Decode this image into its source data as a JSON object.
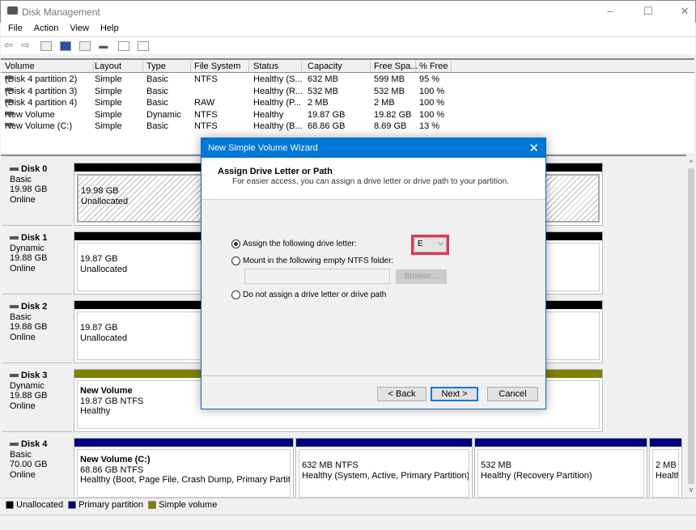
{
  "window": {
    "title": "Disk Management",
    "minimize": "–",
    "maximize": "☐",
    "close": "✕"
  },
  "menu": [
    "File",
    "Action",
    "View",
    "Help"
  ],
  "toolbar": [
    "back-icon",
    "forward-icon",
    "console-tree-icon",
    "help-icon",
    "action-pane-icon",
    "rescan-icon",
    "check-icon",
    "properties-icon"
  ],
  "volume_list": {
    "columns": [
      "Volume",
      "Layout",
      "Type",
      "File System",
      "Status",
      "Capacity",
      "Free Spa...",
      "% Free"
    ],
    "rows": [
      [
        "(Disk 4 partition 2)",
        "Simple",
        "Basic",
        "NTFS",
        "Healthy (S...",
        "632 MB",
        "599 MB",
        "95 %"
      ],
      [
        "(Disk 4 partition 3)",
        "Simple",
        "Basic",
        "",
        "Healthy (R...",
        "532 MB",
        "532 MB",
        "100 %"
      ],
      [
        "(Disk 4 partition 4)",
        "Simple",
        "Basic",
        "RAW",
        "Healthy (P...",
        "2 MB",
        "2 MB",
        "100 %"
      ],
      [
        "New Volume",
        "Simple",
        "Dynamic",
        "NTFS",
        "Healthy",
        "19.87 GB",
        "19.82 GB",
        "100 %"
      ],
      [
        "New Volume (C:)",
        "Simple",
        "Basic",
        "NTFS",
        "Healthy (B...",
        "68.86 GB",
        "8.69 GB",
        "13 %"
      ]
    ]
  },
  "disks": [
    {
      "name": "Disk 0",
      "type": "Basic",
      "size": "19.98 GB",
      "state": "Online",
      "partitions": [
        {
          "title": "",
          "line1": "19.98 GB",
          "line2": "Unallocated"
        }
      ]
    },
    {
      "name": "Disk 1",
      "type": "Dynamic",
      "size": "19.88 GB",
      "state": "Online",
      "partitions": [
        {
          "title": "",
          "line1": "19.87 GB",
          "line2": "Unallocated"
        }
      ]
    },
    {
      "name": "Disk 2",
      "type": "Basic",
      "size": "19.88 GB",
      "state": "Online",
      "partitions": [
        {
          "title": "",
          "line1": "19.87 GB",
          "line2": "Unallocated"
        }
      ]
    },
    {
      "name": "Disk 3",
      "type": "Dynamic",
      "size": "19.88 GB",
      "state": "Online",
      "partitions": [
        {
          "title": "New Volume",
          "line1": "19.87 GB NTFS",
          "line2": "Healthy"
        }
      ]
    },
    {
      "name": "Disk 4",
      "type": "Basic",
      "size": "70.00 GB",
      "state": "Online",
      "partitions": [
        {
          "title": "New Volume  (C:)",
          "line1": "68.86 GB NTFS",
          "line2": "Healthy (Boot, Page File, Crash Dump, Primary Partition)"
        },
        {
          "title": "",
          "line1": "632 MB NTFS",
          "line2": "Healthy (System, Active, Primary Partition)"
        },
        {
          "title": "",
          "line1": "532 MB",
          "line2": "Healthy (Recovery Partition)"
        },
        {
          "title": "",
          "line1": "2 MB",
          "line2": "Healthl"
        }
      ]
    }
  ],
  "legend": [
    {
      "label": "Unallocated",
      "color": "#000000"
    },
    {
      "label": "Primary partition",
      "color": "#000080"
    },
    {
      "label": "Simple volume",
      "color": "#808000"
    }
  ],
  "colors": {
    "unallocated": "#000000",
    "primary": "#000080",
    "simple": "#808000",
    "accent": "#0078d7",
    "highlight": "#e8315a"
  },
  "dialog": {
    "title": "New Simple Volume Wizard",
    "heading": "Assign Drive Letter or Path",
    "subheading": "For easier access, you can assign a drive letter or drive path to your partition.",
    "option_assign": "Assign the following drive letter:",
    "drive_letter": "E",
    "option_mount": "Mount in the following empty NTFS folder:",
    "folder_value": "",
    "browse": "Browse...",
    "option_none": "Do not assign a drive letter or drive path",
    "selected_option": "assign",
    "back": "< Back",
    "next": "Next >",
    "cancel": "Cancel"
  }
}
